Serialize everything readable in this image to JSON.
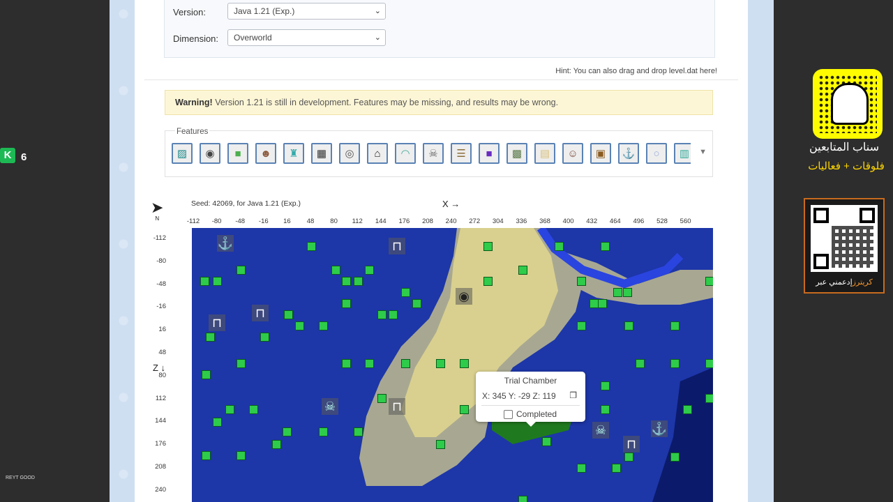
{
  "settings": {
    "version_label": "Version:",
    "version_value": "Java 1.21 (Exp.)",
    "dimension_label": "Dimension:",
    "dimension_value": "Overworld"
  },
  "hint": "Hint: You can also drag and drop level.dat here!",
  "warning": {
    "bold": "Warning!",
    "text": "Version 1.21 is still in development. Features may be missing, and results may be wrong."
  },
  "features": {
    "label": "Features",
    "icons": [
      {
        "icon": "ancient-city-icon",
        "glyph": "▨",
        "color": "#1f8a8a"
      },
      {
        "icon": "ocean-monument-ring-icon",
        "glyph": "◉",
        "color": "#444"
      },
      {
        "icon": "slime-chunk-icon",
        "glyph": "■",
        "color": "#4caf50"
      },
      {
        "icon": "villager-icon",
        "glyph": "☻",
        "color": "#8d5a3c"
      },
      {
        "icon": "potion-icon",
        "glyph": "♜",
        "color": "#3aa"
      },
      {
        "icon": "grid-icon",
        "glyph": "▦",
        "color": "#333"
      },
      {
        "icon": "stronghold-eye-icon",
        "glyph": "◎",
        "color": "#555"
      },
      {
        "icon": "house-icon",
        "glyph": "⌂",
        "color": "#222"
      },
      {
        "icon": "igloo-icon",
        "glyph": "◠",
        "color": "#4a9"
      },
      {
        "icon": "pillager-icon",
        "glyph": "☠",
        "color": "#666"
      },
      {
        "icon": "mineshaft-icon",
        "glyph": "☰",
        "color": "#8a6d3b"
      },
      {
        "icon": "portal-icon",
        "glyph": "■",
        "color": "#6a2cc0"
      },
      {
        "icon": "jungle-temple-icon",
        "glyph": "▩",
        "color": "#5a7a4a"
      },
      {
        "icon": "desert-temple-icon",
        "glyph": "▤",
        "color": "#d9c07a"
      },
      {
        "icon": "witch-hut-icon",
        "glyph": "☺",
        "color": "#7a4a3a"
      },
      {
        "icon": "chest-icon",
        "glyph": "▣",
        "color": "#8b5a1e"
      },
      {
        "icon": "shipwreck-anchor-icon",
        "glyph": "⚓",
        "color": "#222"
      },
      {
        "icon": "end-city-icon",
        "glyph": "○",
        "color": "#9ad"
      },
      {
        "icon": "trail-ruins-icon",
        "glyph": "▥",
        "color": "#3a9"
      }
    ]
  },
  "map": {
    "seed_text": "Seed: 42069, for Java 1.21 (Exp.)",
    "x_axis_title": "X →",
    "z_axis_title": "Z ↓",
    "north_label": "N",
    "x_ticks": [
      "-112",
      "-80",
      "-48",
      "-16",
      "16",
      "48",
      "80",
      "112",
      "144",
      "176",
      "208",
      "240",
      "272",
      "304",
      "336",
      "368",
      "400",
      "432",
      "464",
      "496",
      "528",
      "560"
    ],
    "z_ticks": [
      "-112",
      "-80",
      "-48",
      "-16",
      "16",
      "48",
      "80",
      "112",
      "144",
      "176",
      "208",
      "240"
    ],
    "popup": {
      "title": "Trial Chamber",
      "coords": "X: 345 Y: -29 Z: 119",
      "completed_label": "Completed"
    }
  },
  "overlay": {
    "streamer_badge": "K",
    "streamer_number": "6",
    "corner_text": "REYT GOOD",
    "snap_caption": "سناب المتابعين",
    "snap_subcaption": "فلوقات + فعاليات",
    "qr_caption_prefix": "إدعمني عبر",
    "qr_caption_brand": "كريترز"
  }
}
